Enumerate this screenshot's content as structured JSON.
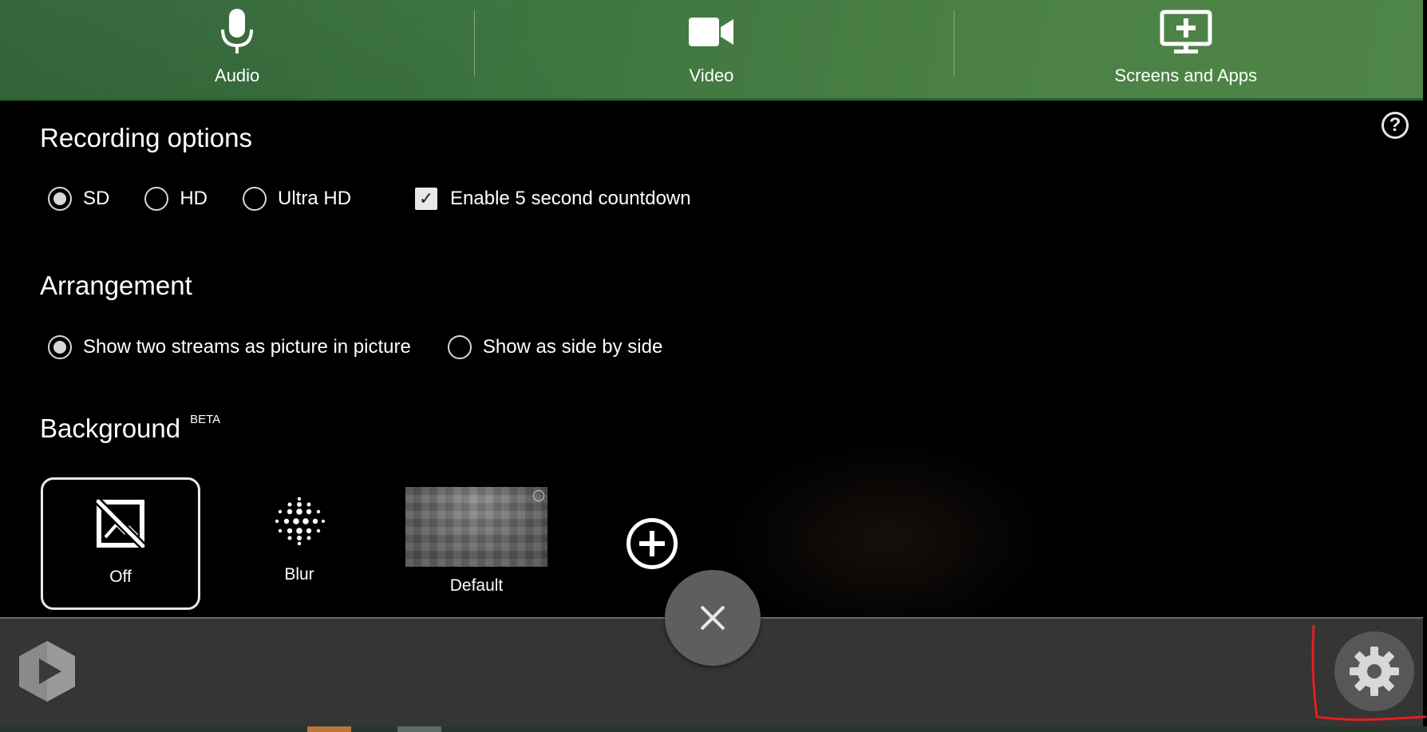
{
  "sources": {
    "audio_label": "Audio",
    "video_label": "Video",
    "screens_label": "Screens and Apps"
  },
  "recording": {
    "title": "Recording options",
    "quality_options": [
      "SD",
      "HD",
      "Ultra HD"
    ],
    "selected_quality": "SD",
    "countdown_label": "Enable 5 second countdown",
    "countdown_checked": true
  },
  "arrangement": {
    "title": "Arrangement",
    "options": [
      "Show two streams as picture in picture",
      "Show as side by side"
    ],
    "selected": "Show two streams as picture in picture"
  },
  "background": {
    "title": "Background",
    "badge": "BETA",
    "tiles": [
      "Off",
      "Blur",
      "Default"
    ],
    "selected": "Off"
  },
  "icons": {
    "help": "?",
    "close": "close-icon",
    "settings": "gear-icon",
    "add": "plus-circle-icon"
  },
  "colors": {
    "topbar_green": "#4b8145",
    "annotation_red": "#e02020",
    "bottombar": "#353535"
  }
}
